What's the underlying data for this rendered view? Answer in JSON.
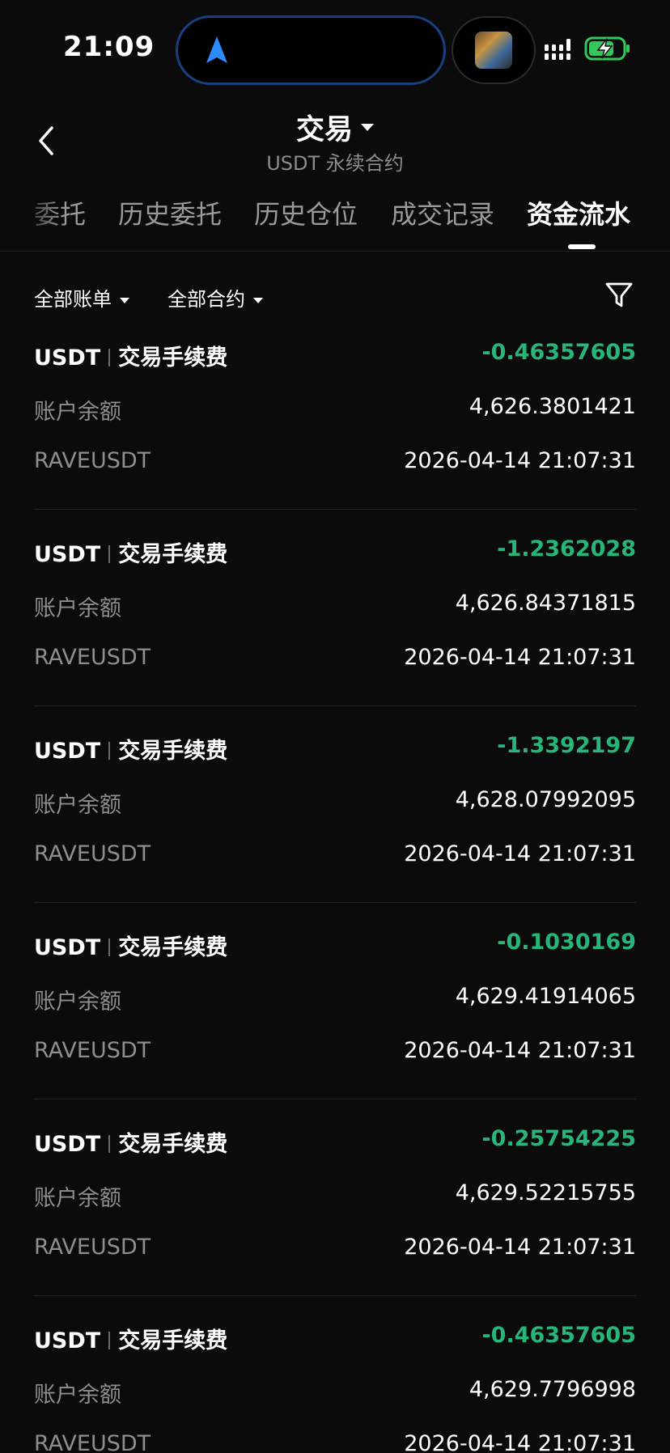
{
  "status_bar": {
    "time": "21:09",
    "icons": [
      "navigation-arrow-icon",
      "now-playing-thumbnail",
      "signal-icon",
      "battery-charging-icon"
    ],
    "accent_color": "#2d8cff",
    "battery_color": "#34c759"
  },
  "header": {
    "title": "交易",
    "subtitle": "USDT 永续合约",
    "back_icon": "chevron-left-icon",
    "title_caret_icon": "caret-down-icon"
  },
  "tabs": [
    {
      "label": "委托",
      "active": false
    },
    {
      "label": "历史委托",
      "active": false
    },
    {
      "label": "历史仓位",
      "active": false
    },
    {
      "label": "成交记录",
      "active": false
    },
    {
      "label": "资金流水",
      "active": true
    }
  ],
  "filters": {
    "bill_type": "全部账单",
    "contract": "全部合约",
    "filter_icon": "funnel-icon"
  },
  "colors": {
    "background": "#0b0b0c",
    "amount_negative": "#27b57a",
    "label": "#8e8e8e",
    "divider": "#222226"
  },
  "labels": {
    "balance": "账户余额"
  },
  "records": [
    {
      "coin": "USDT",
      "type": "交易手续费",
      "amount": "-0.46357605",
      "balance": "4,626.3801421",
      "symbol": "RAVEUSDT",
      "time": "2026-04-14 21:07:31"
    },
    {
      "coin": "USDT",
      "type": "交易手续费",
      "amount": "-1.2362028",
      "balance": "4,626.84371815",
      "symbol": "RAVEUSDT",
      "time": "2026-04-14 21:07:31"
    },
    {
      "coin": "USDT",
      "type": "交易手续费",
      "amount": "-1.3392197",
      "balance": "4,628.07992095",
      "symbol": "RAVEUSDT",
      "time": "2026-04-14 21:07:31"
    },
    {
      "coin": "USDT",
      "type": "交易手续费",
      "amount": "-0.1030169",
      "balance": "4,629.41914065",
      "symbol": "RAVEUSDT",
      "time": "2026-04-14 21:07:31"
    },
    {
      "coin": "USDT",
      "type": "交易手续费",
      "amount": "-0.25754225",
      "balance": "4,629.52215755",
      "symbol": "RAVEUSDT",
      "time": "2026-04-14 21:07:31"
    },
    {
      "coin": "USDT",
      "type": "交易手续费",
      "amount": "-0.46357605",
      "balance": "4,629.7796998",
      "symbol": "RAVEUSDT",
      "time": "2026-04-14 21:07:31"
    }
  ]
}
